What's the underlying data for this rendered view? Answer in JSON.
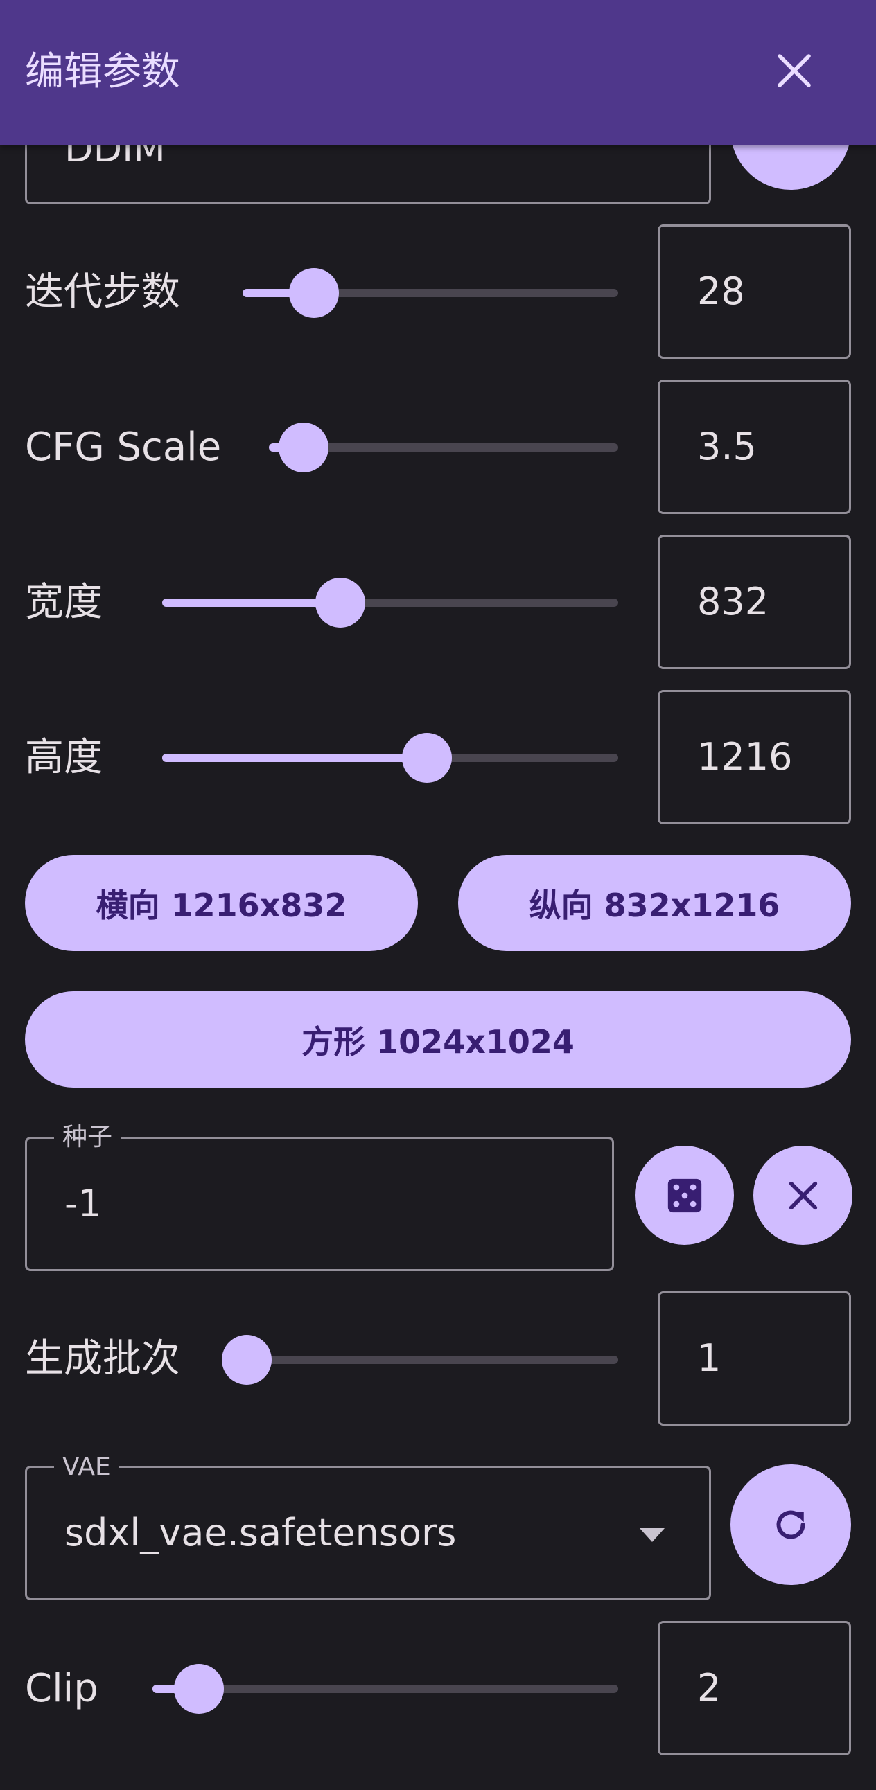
{
  "appbar": {
    "title": "编辑参数",
    "close_icon": "close-icon"
  },
  "sampler": {
    "value_partial": "DDIM"
  },
  "sliders": {
    "steps": {
      "label": "迭代步数",
      "value": "28",
      "fraction": 0.19
    },
    "cfg": {
      "label": "CFG Scale",
      "value": "3.5",
      "fraction": 0.1
    },
    "width": {
      "label": "宽度",
      "value": "832",
      "fraction": 0.39
    },
    "height": {
      "label": "高度",
      "value": "1216",
      "fraction": 0.58
    },
    "batch": {
      "label": "生成批次",
      "value": "1",
      "fraction": 0.0
    },
    "clip": {
      "label": "Clip",
      "value": "2",
      "fraction": 0.1
    }
  },
  "presets": {
    "landscape": "横向 1216x832",
    "portrait": "纵向 832x1216",
    "square": "方形 1024x1024"
  },
  "seed": {
    "label": "种子",
    "value": "-1",
    "random_icon": "dice-icon",
    "clear_icon": "close-icon"
  },
  "vae": {
    "label": "VAE",
    "value": "sdxl_vae.safetensors",
    "dropdown_icon": "caret-down-icon",
    "refresh_icon": "refresh-icon"
  },
  "colors": {
    "appbar": "#4f378b",
    "background": "#1c1b20",
    "accent": "#d0bcff",
    "on_accent": "#381e72",
    "outline": "#938f99"
  }
}
